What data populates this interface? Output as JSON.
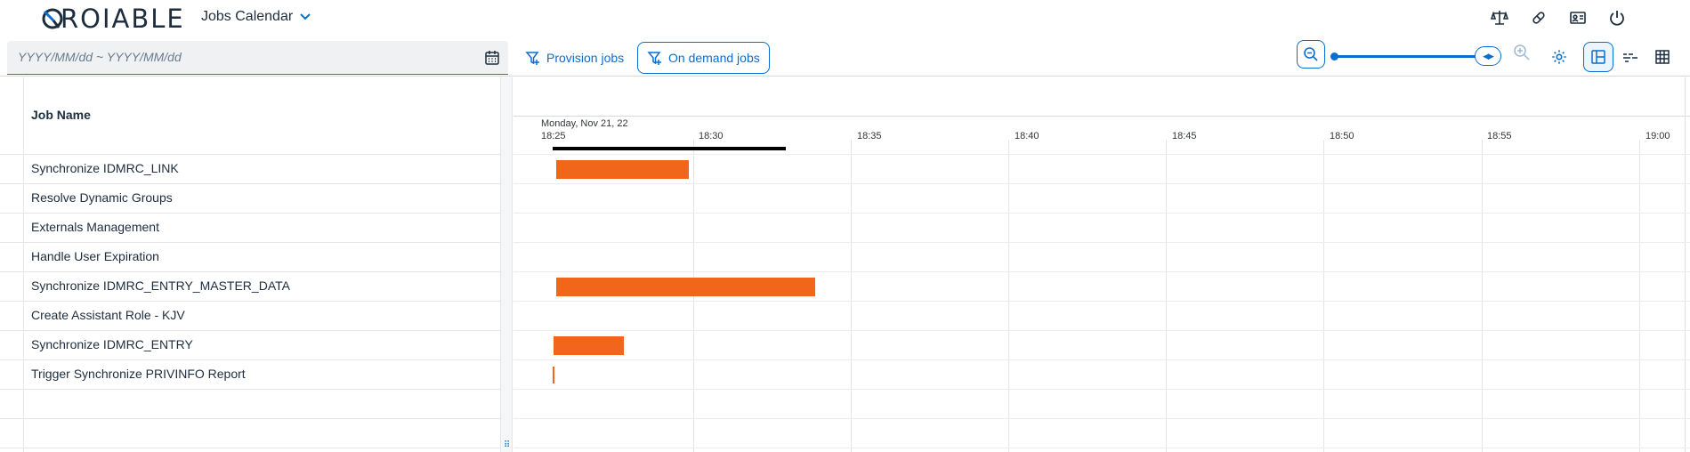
{
  "header": {
    "logo_text": "ROIABLE",
    "app_title": "Jobs Calendar",
    "icons": [
      "scale-icon",
      "pill-icon",
      "id-card-icon",
      "power-icon"
    ]
  },
  "toolbar": {
    "date_placeholder": "YYYY/MM/dd ~ YYYY/MM/dd",
    "provision_label": "Provision jobs",
    "on_demand_label": "On demand jobs",
    "accent_color": "#0a6ed1"
  },
  "table": {
    "column_header": "Job Name",
    "jobs": [
      "Synchronize IDMRC_LINK",
      "Resolve Dynamic Groups",
      "Externals Management",
      "Handle User Expiration",
      "Synchronize IDMRC_ENTRY_MASTER_DATA",
      "Create Assistant Role - KJV",
      "Synchronize IDMRC_ENTRY",
      "Trigger Synchronize PRIVINFO Report"
    ]
  },
  "gantt": {
    "date_label": "Monday, Nov 21, 22",
    "ticks": [
      "18:25",
      "18:30",
      "18:35",
      "18:40",
      "18:45",
      "18:50",
      "18:55",
      "19:00"
    ],
    "bar_color": "#f2661c"
  }
}
